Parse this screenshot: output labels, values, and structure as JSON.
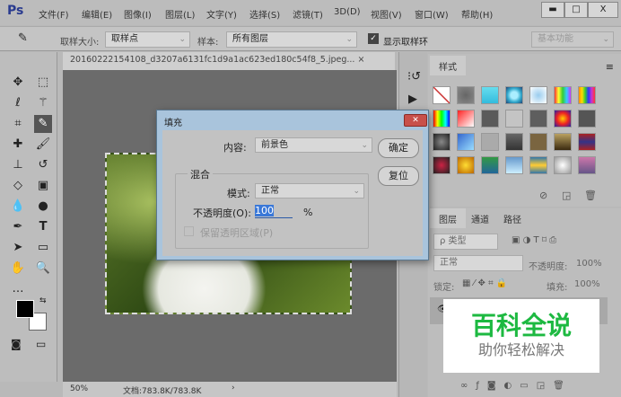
{
  "app": {
    "logo": "Ps",
    "menu": [
      "文件(F)",
      "编辑(E)",
      "图像(I)",
      "图层(L)",
      "文字(Y)",
      "选择(S)",
      "滤镜(T)",
      "3D(D)",
      "视图(V)",
      "窗口(W)",
      "帮助(H)"
    ],
    "win": [
      "▬",
      "□",
      "X"
    ]
  },
  "options": {
    "sample_size_label": "取样大小:",
    "sample_size_value": "取样点",
    "sample_label": "样本:",
    "sample_value": "所有图层",
    "show_ring_label": "显示取样环",
    "show_ring_checked": true,
    "workspace": "基本功能"
  },
  "document": {
    "tab_title": "20160222154108_d3207a6131fc1d9a1ac623ed180c54f8_5.jpeg...",
    "close": "×",
    "zoom": "50%",
    "doc_info": "文档:783.8K/783.8K",
    "arrow": "›"
  },
  "styles_panel": {
    "tab": "样式",
    "menu": "≡"
  },
  "layers_panel": {
    "tabs": [
      "图层",
      "通道",
      "路径"
    ],
    "filter": "ρ 类型",
    "blend_mode": "正常",
    "opacity_label": "不透明度:",
    "opacity": "100%",
    "lock_label": "锁定:",
    "fill_label": "填充:",
    "fill": "100%",
    "footer_icons": [
      "link-icon",
      "fx-icon",
      "mask-icon",
      "adjustment-icon",
      "folder-icon",
      "new-layer-icon",
      "trash-icon"
    ]
  },
  "dialog": {
    "title": "填充",
    "content_label": "内容:",
    "content_value": "前景色",
    "ok": "确定",
    "reset": "复位",
    "blend_group": "混合",
    "mode_label": "模式:",
    "mode_value": "正常",
    "opacity_label": "不透明度(O):",
    "opacity_value": "100",
    "percent": "%",
    "preserve_label": "保留透明区域(P)",
    "preserve_checked": false
  },
  "watermark": {
    "title": "百科全说",
    "subtitle": "助你轻松解决"
  },
  "colors": {
    "foreground": "#000000",
    "background": "#ffffff",
    "watermark_green": "#1db941"
  }
}
